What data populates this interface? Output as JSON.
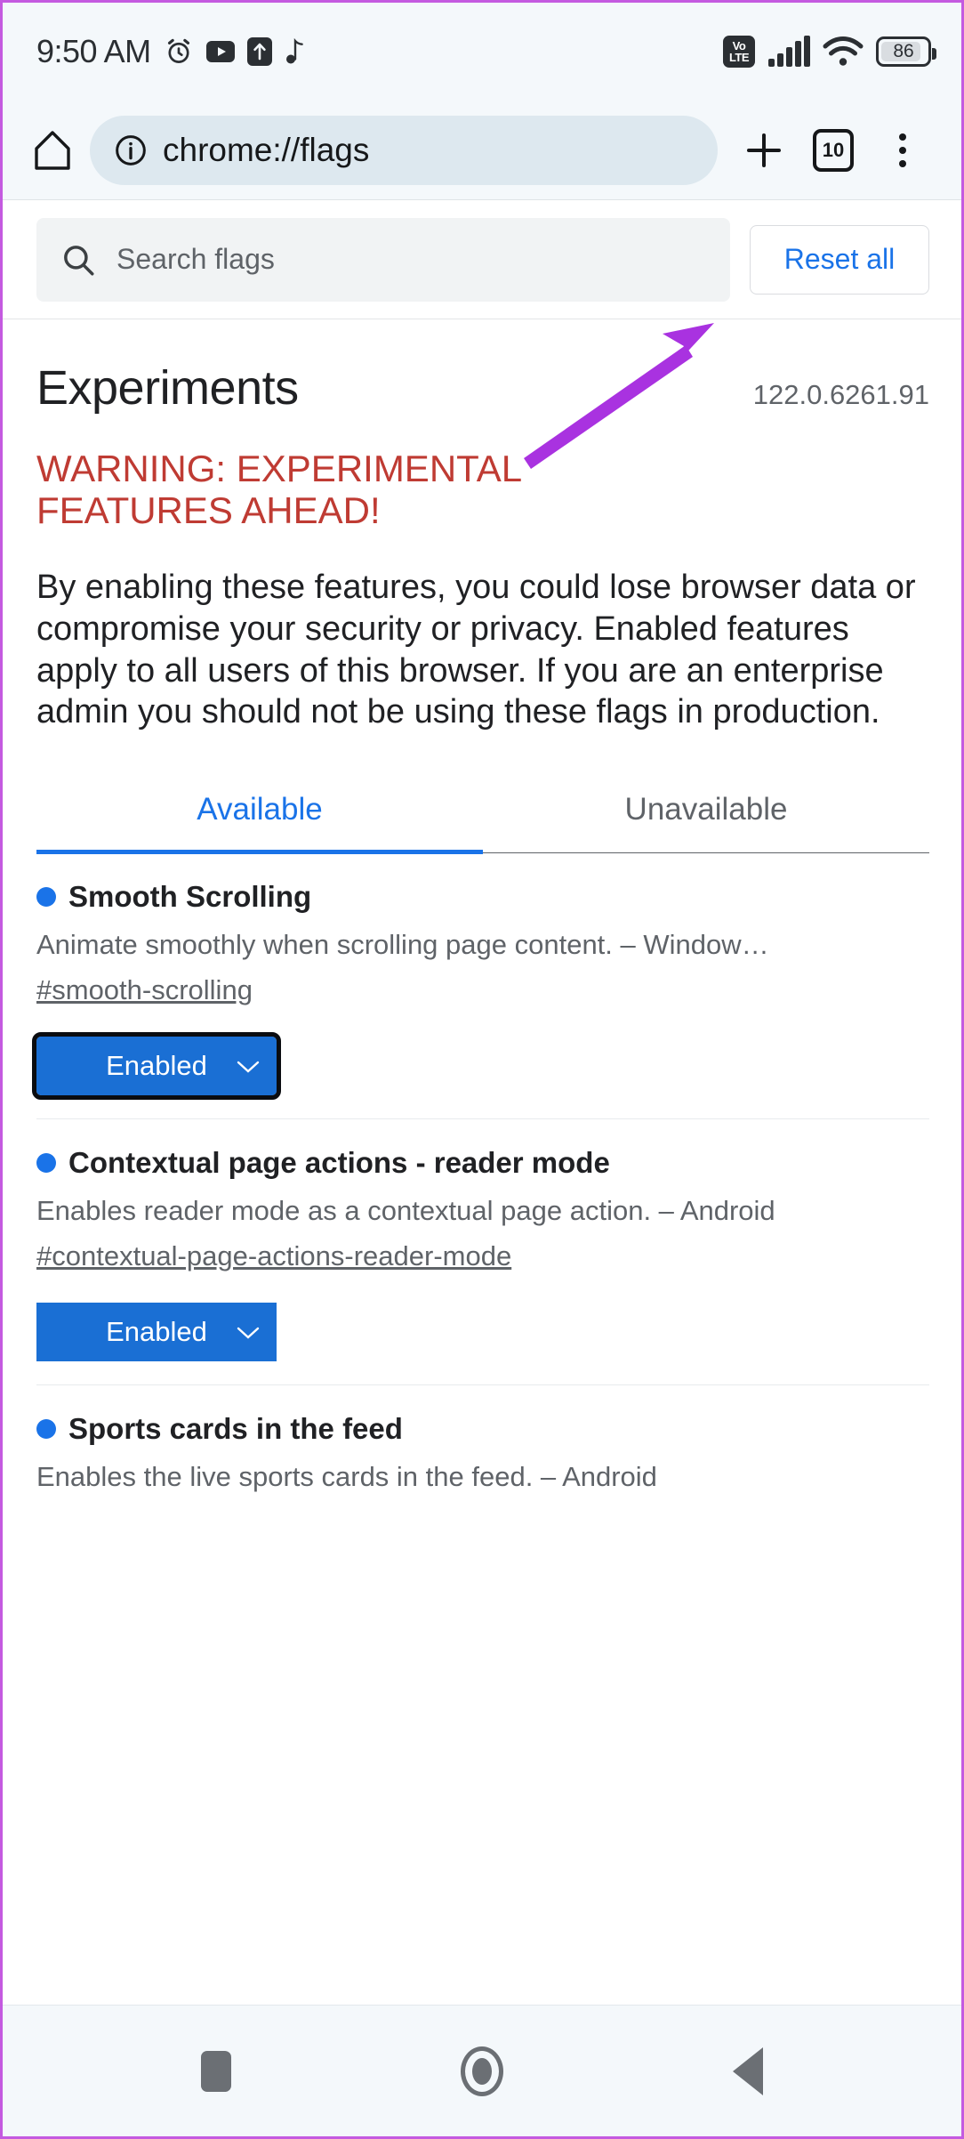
{
  "status_bar": {
    "time": "9:50 AM",
    "left_icons": [
      "alarm-clock-icon",
      "youtube-icon",
      "upload-icon",
      "tiktok-note-icon"
    ],
    "volte_top": "Vo",
    "volte_bottom": "LTE",
    "signal_icon": "cellular-signal-icon",
    "wifi_icon": "wifi-icon",
    "battery_level": "86"
  },
  "toolbar": {
    "home_icon": "home-icon",
    "page_info_icon": "info-circle-icon",
    "url": "chrome://flags",
    "new_tab_icon": "plus-icon",
    "tab_count": "10",
    "menu_icon": "three-dot-menu-icon"
  },
  "search": {
    "icon": "search-icon",
    "placeholder": "Search flags",
    "value": "",
    "reset_label": "Reset all"
  },
  "page": {
    "title": "Experiments",
    "version": "122.0.6261.91",
    "warning": "WARNING: EXPERIMENTAL FEATURES AHEAD!",
    "blurb": "By enabling these features, you could lose browser data or compromise your security or privacy. Enabled features apply to all users of this browser. If you are an enterprise admin you should not be using these flags in production."
  },
  "tabs": [
    {
      "label": "Available",
      "active": true
    },
    {
      "label": "Unavailable",
      "active": false
    }
  ],
  "flags": [
    {
      "title": "Smooth Scrolling",
      "description": "Animate smoothly when scrolling page content. – Window…",
      "anchor": "#smooth-scrolling",
      "state": "Enabled",
      "focused": true
    },
    {
      "title": "Contextual page actions - reader mode",
      "description": "Enables reader mode as a contextual page action. – Android",
      "anchor": "#contextual-page-actions-reader-mode",
      "state": "Enabled",
      "focused": false
    },
    {
      "title": "Sports cards in the feed",
      "description": "Enables the live sports cards in the feed. – Android",
      "anchor": "",
      "state": "",
      "focused": false
    }
  ],
  "annotation": {
    "color": "#a932e0",
    "points_to": "reset-all-button"
  },
  "nav_bar": {
    "recents_icon": "recent-apps-square-icon",
    "home_icon": "home-circle-icon",
    "back_icon": "back-triangle-icon"
  },
  "colors": {
    "accent_blue": "#1a73e8",
    "warning_red": "#bf3b33",
    "select_blue": "#1a6fd4",
    "annotation_purple": "#a932e0"
  }
}
